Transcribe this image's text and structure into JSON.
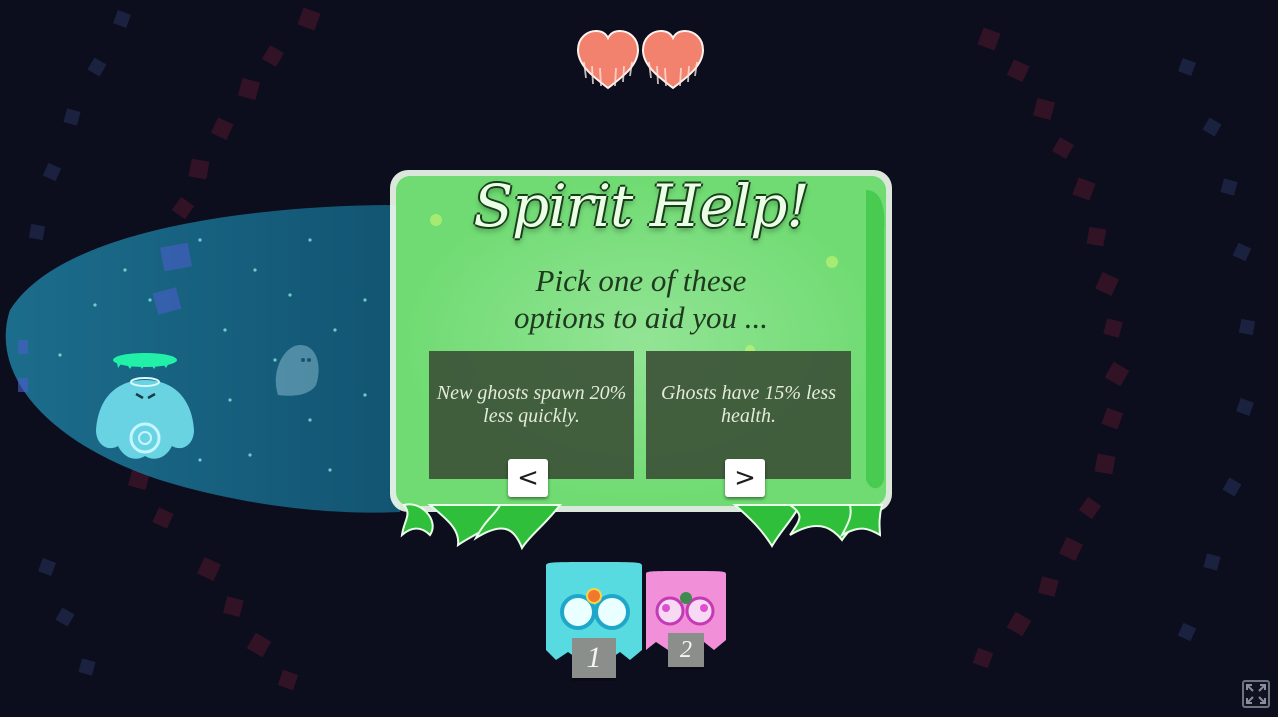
{
  "hud": {
    "hearts": 2,
    "heart_color": "#f2826e"
  },
  "modal": {
    "title": "Spirit Help!",
    "subtitle_line1": "Pick one of these",
    "subtitle_line2": "options to aid you ...",
    "panel_color": "#6fdb72",
    "options": [
      {
        "text": "New ghosts spawn 20% less quickly.",
        "nav": "<"
      },
      {
        "text": "Ghosts have 15% less health.",
        "nav": ">"
      }
    ]
  },
  "inventory": {
    "slots": [
      {
        "number": "1",
        "color": "#58dbe0",
        "icon": "cyan-goggles-icon"
      },
      {
        "number": "2",
        "color": "#f28fd9",
        "icon": "pink-goggles-icon"
      }
    ]
  },
  "controls": {
    "fullscreen_icon": "fullscreen-icon"
  }
}
